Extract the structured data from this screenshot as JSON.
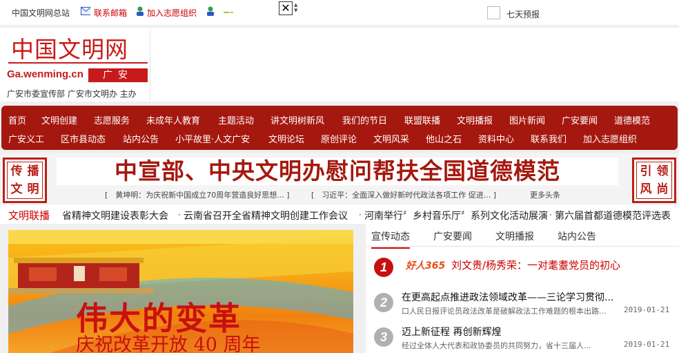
{
  "topbar": {
    "site_home": "中国文明网总站",
    "mail_link": "联系邮箱",
    "volunteer_link": "加入志愿组织",
    "weather_label": "七天预报"
  },
  "logo": {
    "title": "中国文明网",
    "domain": "Ga.wenming.cn",
    "city": "广安",
    "host": "广安市委宣传部 广安市文明办 主办"
  },
  "nav": {
    "row1": [
      "首页",
      "文明创建",
      "志愿服务",
      "未成年人教育",
      "主题活动",
      "讲文明树新风",
      "我们的节日",
      "联盟联播",
      "文明播报",
      "图片新闻",
      "广安要闻",
      "道德模范"
    ],
    "row2": [
      "广安义工",
      "区市县动态",
      "站内公告",
      "小平故里·人文广安",
      "文明论坛",
      "原创评论",
      "文明风采",
      "他山之石",
      "资料中心",
      "联系我们",
      "加入志愿组织"
    ]
  },
  "banner": {
    "left_seal": [
      "传",
      "播",
      "文",
      "明"
    ],
    "right_seal": [
      "引",
      "领",
      "风",
      "尚"
    ],
    "headline": "中宣部、中央文明办慰问帮扶全国道德模范",
    "sub1": "[　黄坤明：为庆祝新中国成立70周年营造良好思想... ]",
    "sub2": "[　习近平：全面深入做好新时代政法各项工作 促进... ]",
    "more": "更多头条"
  },
  "ticker": {
    "label": "文明联播",
    "items": [
      "省精神文明建设表彰大会",
      "云南省召开全省精神文明创建工作会议",
      "河南举行〞乡村音乐厅〞系列文化活动展演",
      "第六届首都道德模范评选表"
    ]
  },
  "hero": {
    "title": "伟大的变革",
    "subtitle": "庆祝改革开放 40 周年"
  },
  "news_panel": {
    "tabs": [
      "宣传动态",
      "广安要闻",
      "文明播报",
      "站内公告"
    ],
    "brand": "好人365",
    "top_item": {
      "num": "1",
      "title": "刘文贵/杨秀荣：一对耄耋党员的初心"
    },
    "items": [
      {
        "num": "2",
        "title": "在更高起点推进政法领域改革——三论学习贯彻...",
        "desc": "口人民日报评论员政法改革是破解政法工作难题的根本出路...",
        "date": "2019-01-21"
      },
      {
        "num": "3",
        "title": "迈上新征程 再创新辉煌",
        "desc": "经过全体人大代表和政协委员的共同努力，省十三届人...",
        "date": "2019-01-21"
      }
    ]
  },
  "colors": {
    "brand_red": "#a5180f",
    "link_red": "#cc0000",
    "hero_orange": "#f6a416"
  }
}
